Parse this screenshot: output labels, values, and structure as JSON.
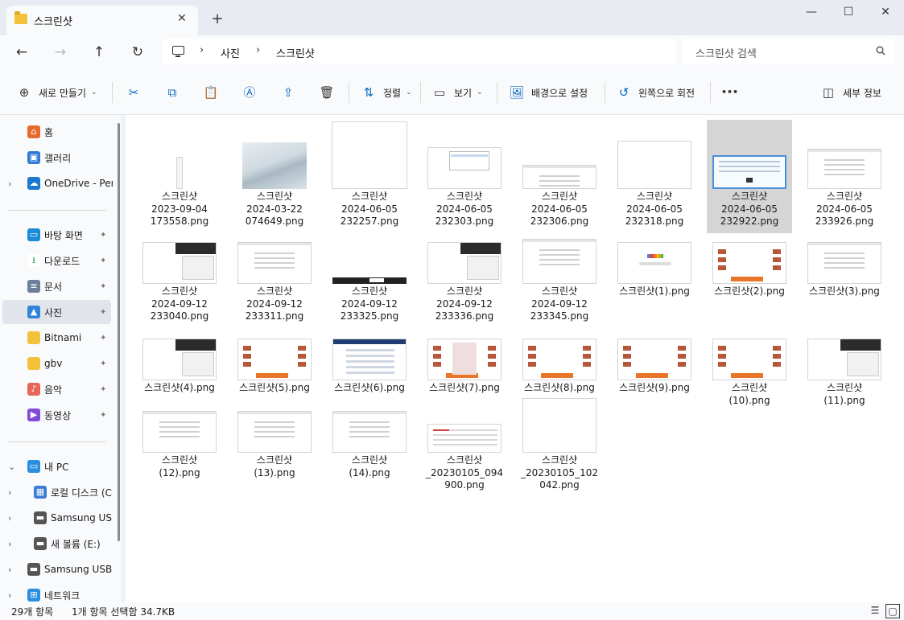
{
  "tab": {
    "title": "스크린샷",
    "close_glyph": "✕",
    "new_glyph": "+"
  },
  "window": {
    "minimize": "—",
    "maximize": "☐",
    "close": "✕"
  },
  "nav": {
    "back": "←",
    "forward": "→",
    "up": "↑",
    "refresh": "↻"
  },
  "breadcrumb": {
    "sep": "›",
    "items": [
      "사진",
      "스크린샷"
    ]
  },
  "search": {
    "placeholder": "스크린샷 검색"
  },
  "toolbar": {
    "new_label": "새로 만들기",
    "sort_label": "정렬",
    "view_label": "보기",
    "set_background_label": "배경으로 설정",
    "rotate_left_label": "왼쪽으로 회전",
    "more_label": "•••",
    "details_label": "세부 정보",
    "caret": "⌄"
  },
  "sidebar": {
    "items": [
      {
        "label": "홈",
        "icon": "home-icon"
      },
      {
        "label": "갤러리",
        "icon": "gallery-icon"
      },
      {
        "label": "OneDrive - Pers",
        "icon": "onedrive-icon"
      },
      {
        "label": "바탕 화면",
        "icon": "desktop-icon"
      },
      {
        "label": "다운로드",
        "icon": "download-icon"
      },
      {
        "label": "문서",
        "icon": "documents-icon"
      },
      {
        "label": "사진",
        "icon": "pictures-icon"
      },
      {
        "label": "Bitnami",
        "icon": "folder-icon"
      },
      {
        "label": "gbv",
        "icon": "folder-icon"
      },
      {
        "label": "음악",
        "icon": "music-icon"
      },
      {
        "label": "동영상",
        "icon": "videos-icon"
      },
      {
        "label": "내 PC",
        "icon": "pc-icon"
      },
      {
        "label": "로컬 디스크 (C",
        "icon": "drive-icon"
      },
      {
        "label": "Samsung USB",
        "icon": "usb-icon"
      },
      {
        "label": "새 볼륨 (E:)",
        "icon": "drive-icon"
      },
      {
        "label": "Samsung USB (",
        "icon": "usb-icon"
      },
      {
        "label": "네트워크",
        "icon": "network-icon"
      }
    ],
    "pin_glyph": "📌",
    "chev_right": "›",
    "chev_down": "⌄"
  },
  "files": [
    "스크린샷\n2023-09-04\n173558.png",
    "스크린샷\n2024-03-22\n074649.png",
    "스크린샷\n2024-06-05\n232257.png",
    "스크린샷\n2024-06-05\n232303.png",
    "스크린샷\n2024-06-05\n232306.png",
    "스크린샷\n2024-06-05\n232318.png",
    "스크린샷\n2024-06-05\n232922.png",
    "스크린샷\n2024-06-05\n233926.png",
    "스크린샷\n2024-09-12\n233040.png",
    "스크린샷\n2024-09-12\n233311.png",
    "스크린샷\n2024-09-12\n233325.png",
    "스크린샷\n2024-09-12\n233336.png",
    "스크린샷\n2024-09-12\n233345.png",
    "스크린샷(1).png",
    "스크린샷(2).png",
    "스크린샷(3).png",
    "스크린샷(4).png",
    "스크린샷(5).png",
    "스크린샷(6).png",
    "스크린샷(7).png",
    "스크린샷(8).png",
    "스크린샷(9).png",
    "스크린샷\n(10).png",
    "스크린샷\n(11).png",
    "스크린샷\n(12).png",
    "스크린샷\n(13).png",
    "스크린샷\n(14).png",
    "스크린샷\n_20230105_094\n900.png",
    "스크린샷\n_20230105_102\n042.png"
  ],
  "selected_file_index": 6,
  "status": {
    "count": "29개 항목",
    "selection": "1개 항목 선택함 34.7KB"
  },
  "colors": {
    "accent": "#0a68c4",
    "folder": "#f3c13a",
    "selected_bg": "#d5d5d5"
  }
}
